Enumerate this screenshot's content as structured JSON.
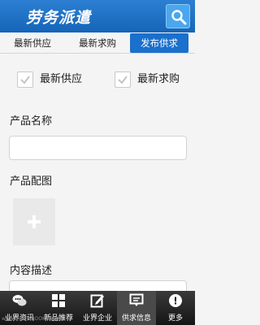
{
  "header": {
    "title": "劳务派遣",
    "search_icon": "search-icon"
  },
  "tabs": [
    {
      "label": "最新供应",
      "active": false
    },
    {
      "label": "最新求购",
      "active": false
    },
    {
      "label": "发布供求",
      "active": true
    }
  ],
  "form": {
    "checkboxes": [
      {
        "label": "最新供应",
        "checked": true
      },
      {
        "label": "最新求购",
        "checked": true
      }
    ],
    "product_name_label": "产品名称",
    "product_name_value": "",
    "product_image_label": "产品配图",
    "description_label": "内容描述"
  },
  "bottom_nav": [
    {
      "label": "业界资讯",
      "icon": "chat-icon",
      "active": false
    },
    {
      "label": "新品推荐",
      "icon": "grid-icon",
      "active": false
    },
    {
      "label": "业界企业",
      "icon": "edit-icon",
      "active": false
    },
    {
      "label": "供求信息",
      "icon": "message-icon",
      "active": true
    },
    {
      "label": "更多",
      "icon": "more-icon",
      "active": false
    }
  ],
  "watermark": "www.d.com  BOOKA.COM"
}
